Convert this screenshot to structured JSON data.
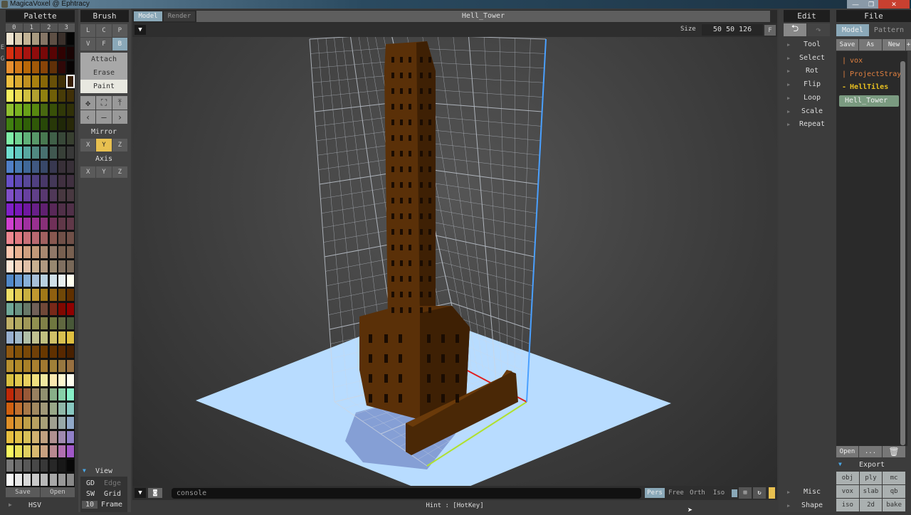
{
  "window": {
    "title": "MagicaVoxel @ Ephtracy",
    "minimize": "—",
    "restore": "❐",
    "close": "✕"
  },
  "palette": {
    "title": "Palette",
    "pages": [
      "0",
      "1",
      "2",
      "3"
    ],
    "side_labels": [
      "E",
      "G"
    ],
    "save": "Save",
    "open": "Open",
    "hsv": "HSV",
    "rows": [
      [
        "#f0e6d2",
        "#d8cbb0",
        "#c4b496",
        "#a89a80",
        "#857666",
        "#5e5045",
        "#3a302b",
        "#050505"
      ],
      [
        "#d83010",
        "#c02010",
        "#a81410",
        "#900c0c",
        "#780808",
        "#580404",
        "#300202",
        "#180404"
      ],
      [
        "#e89030",
        "#d07818",
        "#b86808",
        "#a05808",
        "#884408",
        "#603008",
        "#300808",
        "#080404"
      ],
      [
        "#f0c040",
        "#d8a830",
        "#c09020",
        "#a88010",
        "#886808",
        "#685008",
        "#403008",
        "#382008"
      ],
      [
        "#f8f060",
        "#e8d850",
        "#d0c040",
        "#b0a030",
        "#908010",
        "#706008",
        "#483c08",
        "#403008"
      ],
      [
        "#90c030",
        "#78b020",
        "#68a018",
        "#588810",
        "#486810",
        "#385008",
        "#303808",
        "#303008"
      ],
      [
        "#408010",
        "#387008",
        "#306008",
        "#305808",
        "#284808",
        "#283808",
        "#202808",
        "#282808"
      ],
      [
        "#80f0a8",
        "#70d090",
        "#60b078",
        "#589868",
        "#487850",
        "#406048",
        "#384838",
        "#384030"
      ],
      [
        "#70e0d0",
        "#60c8c0",
        "#58a8a0",
        "#508880",
        "#487070",
        "#405850",
        "#384038",
        "#383838"
      ],
      [
        "#5080c8",
        "#4878b0",
        "#406898",
        "#405880",
        "#384868",
        "#383850",
        "#383038",
        "#383038"
      ],
      [
        "#6850c8",
        "#5c48b0",
        "#584898",
        "#504080",
        "#483868",
        "#443858",
        "#403040",
        "#403040"
      ],
      [
        "#8050c8",
        "#7048b8",
        "#6840a0",
        "#604088",
        "#583870",
        "#503858",
        "#483840",
        "#483840"
      ],
      [
        "#8020c8",
        "#7818b8",
        "#7018a0",
        "#682088",
        "#602070",
        "#582858",
        "#503048",
        "#503048"
      ],
      [
        "#d040d0",
        "#b838b8",
        "#a030a0",
        "#983090",
        "#883078",
        "#703058",
        "#603848",
        "#603848"
      ],
      [
        "#f08890",
        "#e07880",
        "#c87078",
        "#b86870",
        "#a06060",
        "#885850",
        "#705048",
        "#705048"
      ],
      [
        "#ffc8b0",
        "#e8b090",
        "#d0a080",
        "#c09878",
        "#a88870",
        "#907868",
        "#786050",
        "#786050"
      ],
      [
        "#ffe8d8",
        "#f0d0b8",
        "#e0c0a8",
        "#c8b090",
        "#b09880",
        "#988870",
        "#807060",
        "#786858"
      ],
      [
        "#5088c8",
        "#6898d0",
        "#88b0d8",
        "#a8c0d8",
        "#b8d0e0",
        "#d0e0e8",
        "#e8f0f0",
        "#fffff0"
      ],
      [
        "#f0e068",
        "#e0c850",
        "#c8b040",
        "#c09830",
        "#a07818",
        "#906010",
        "#704808",
        "#603000"
      ],
      [
        "#70a898",
        "#689080",
        "#687868",
        "#706058",
        "#704838",
        "#782818",
        "#800800",
        "#900000"
      ],
      [
        "#c0b068",
        "#b0a860",
        "#a09858",
        "#909050",
        "#808048",
        "#707840",
        "#606840",
        "#485838"
      ],
      [
        "#98b0d0",
        "#a0b8c8",
        "#b0c0a8",
        "#c0c090",
        "#c0c080",
        "#d0c068",
        "#d8c050",
        "#e0c040"
      ],
      [
        "#905810",
        "#805008",
        "#784808",
        "#704008",
        "#683800",
        "#603000",
        "#582800",
        "#482000"
      ],
      [
        "#b89030",
        "#b08828",
        "#a88028",
        "#a88030",
        "#a07830",
        "#a08038",
        "#987840",
        "#987040"
      ],
      [
        "#d8c040",
        "#e0c850",
        "#e8d060",
        "#f0e080",
        "#f0e8a0",
        "#f8e8b0",
        "#fff8d0",
        "#fffff0"
      ],
      [
        "#c02808",
        "#a84020",
        "#985838",
        "#988060",
        "#909070",
        "#88b088",
        "#88d0a8",
        "#88f0c8"
      ],
      [
        "#d06010",
        "#c07030",
        "#a87848",
        "#a08860",
        "#a09878",
        "#98a888",
        "#90b8a8",
        "#88c8c0"
      ],
      [
        "#e09028",
        "#d09838",
        "#c0a048",
        "#b8a060",
        "#a8a078",
        "#a0a090",
        "#98a8a8",
        "#90a8c8"
      ],
      [
        "#e8c040",
        "#e0c048",
        "#d8c058",
        "#d0b070",
        "#c0a080",
        "#b09090",
        "#a08ab0",
        "#9080c8"
      ],
      [
        "#f8f860",
        "#e8e058",
        "#e0d060",
        "#d8b870",
        "#c8a080",
        "#b88890",
        "#b070b0",
        "#a058c8"
      ],
      [
        "#787878",
        "#686868",
        "#585858",
        "#484848",
        "#383838",
        "#282828",
        "#181818",
        "#080808"
      ],
      [
        "#f8f8f8",
        "#e8e8e8",
        "#d8d8d8",
        "#c8c8c8",
        "#b8b8b8",
        "#a8a8a8",
        "#989898",
        "#888888"
      ]
    ],
    "selected": {
      "row": 3,
      "col": 7
    }
  },
  "brush": {
    "title": "Brush",
    "modes": [
      "L",
      "C",
      "P",
      "V",
      "F",
      "B"
    ],
    "active_mode": "B",
    "actions": [
      "Attach",
      "Erase",
      "Paint"
    ],
    "active_action": "Paint",
    "tool_icons": [
      "move-icon",
      "select-box-icon",
      "extrude-icon",
      "chevron-left-icon",
      "minus-icon",
      "chevron-right-icon"
    ],
    "mirror_label": "Mirror",
    "mirror": [
      "X",
      "Y",
      "Z"
    ],
    "mirror_active": "Y",
    "axis_label": "Axis",
    "axis": [
      "X",
      "Y",
      "Z"
    ]
  },
  "view": {
    "label": "View",
    "items": [
      [
        "GD",
        "Edge"
      ],
      [
        "SW",
        "Grid"
      ],
      [
        "10",
        "Frame"
      ]
    ]
  },
  "viewport": {
    "tabs": [
      "Model",
      "Render"
    ],
    "active_tab": "Model",
    "title": "Hell_Tower",
    "size_label": "Size",
    "size_value": "50 50 126",
    "f_button": "F",
    "console_placeholder": "console",
    "cameras": [
      "Pers",
      "Free",
      "Orth",
      "Iso"
    ],
    "active_camera": "Pers",
    "hint": "Hint : [HotKey]",
    "colors": {
      "floor": "#b8dcff",
      "voxel": "#5a3008"
    }
  },
  "edit": {
    "title": "Edit",
    "items": [
      "Tool",
      "Select",
      "Rot",
      "Flip",
      "Loop",
      "Scale",
      "Repeat"
    ],
    "bottom_items": [
      "Misc",
      "Shape"
    ]
  },
  "file": {
    "title": "File",
    "tabs": [
      "Model",
      "Pattern"
    ],
    "actions": [
      "Save",
      "As",
      "New",
      "+"
    ],
    "items": [
      {
        "prefix": "|",
        "name": "vox",
        "color": "#e08040"
      },
      {
        "prefix": "|",
        "name": "ProjectStray",
        "color": "#e08040"
      },
      {
        "prefix": "-",
        "name": "HellTiles",
        "color": "#e8c020"
      },
      {
        "prefix": "",
        "name": "Hell_Tower",
        "color": "#eeeeee"
      }
    ],
    "selected": "Hell_Tower",
    "bottom": [
      "Open",
      "..."
    ],
    "export_label": "Export",
    "export": [
      "obj",
      "ply",
      "mc",
      "vox",
      "slab",
      "qb",
      "iso",
      "2d",
      "bake"
    ]
  }
}
